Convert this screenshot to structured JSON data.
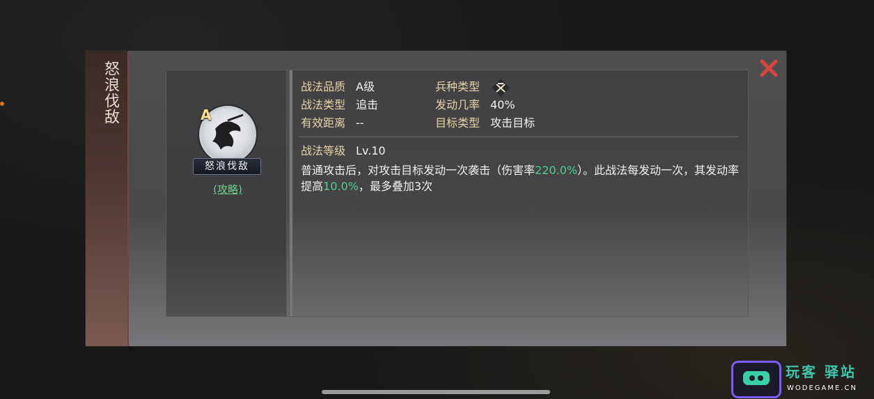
{
  "modal": {
    "side_title": "怒浪伐敌",
    "close_icon": "close-icon",
    "accent_color": "#d9443c"
  },
  "skill_card": {
    "grade": "A",
    "name": "怒浪伐敌",
    "strategy_link": "(攻略)"
  },
  "details": {
    "quality_label": "战法品质",
    "quality_value": "A级",
    "troop_type_label": "兵种类型",
    "troop_type_icon": "crossed-weapons-icon",
    "skill_type_label": "战法类型",
    "skill_type_value": "追击",
    "trigger_rate_label": "发动几率",
    "trigger_rate_value": "40%",
    "range_label": "有效距离",
    "range_value": "--",
    "target_label": "目标类型",
    "target_value": "攻击目标",
    "level_label": "战法等级",
    "level_value": "Lv.10"
  },
  "description": {
    "part1": "普通攻击后，对攻击目标发动一次袭击（伤害率",
    "damage_rate": "220.0%",
    "part2": "）。此战法每发动一次，其发动率提高",
    "increase_rate": "10.0%",
    "part3": "，最多叠加3次"
  },
  "watermark": {
    "text": "玩客 驿站",
    "sub": "WODEGAME.CN"
  }
}
